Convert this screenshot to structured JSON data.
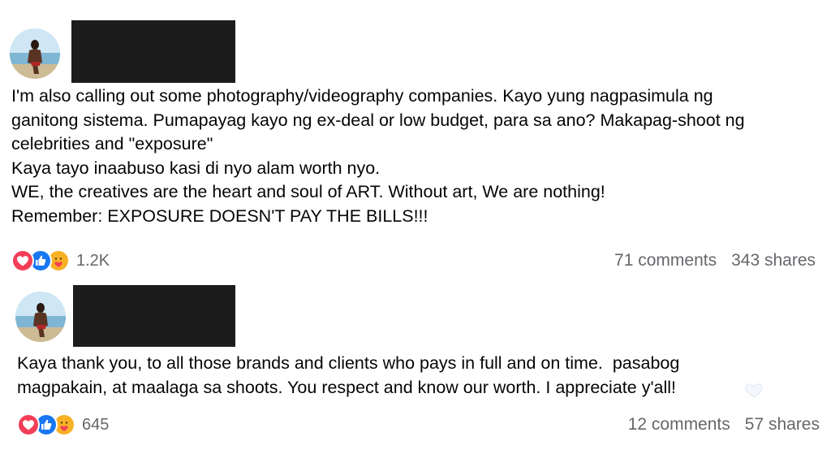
{
  "posts": [
    {
      "body": "I'm also calling out some photography/videography companies. Kayo yung nagpasimula ng\nganitong sistema. Pumapayag kayo ng ex-deal or low budget, para sa ano? Makapag-shoot ng\ncelebrities and \"exposure\"\nKaya tayo inaabuso kasi di nyo alam worth nyo.\nWE, the creatives are the heart and soul of ART. Without art, We are nothing!\nRemember: EXPOSURE DOESN'T PAY THE BILLS!!!",
      "reaction_count": "1.2K",
      "comments": "71 comments",
      "shares": "343 shares",
      "reactions": [
        "love-icon",
        "like-icon",
        "care-icon"
      ]
    },
    {
      "body": "Kaya thank you, to all those brands and clients who pays in full and on time.  pasabog\nmagpakain, at maalaga sa shoots. You respect and know our worth. I appreciate y'all!",
      "reaction_count": "645",
      "comments": "12 comments",
      "shares": "57 shares",
      "reactions": [
        "love-icon",
        "like-icon",
        "care-icon"
      ]
    }
  ],
  "colors": {
    "love": "#f33e58",
    "like": "#1877f2",
    "care": "#f7b125",
    "meta_text": "#65676b",
    "redaction": "#1c1c1c"
  }
}
